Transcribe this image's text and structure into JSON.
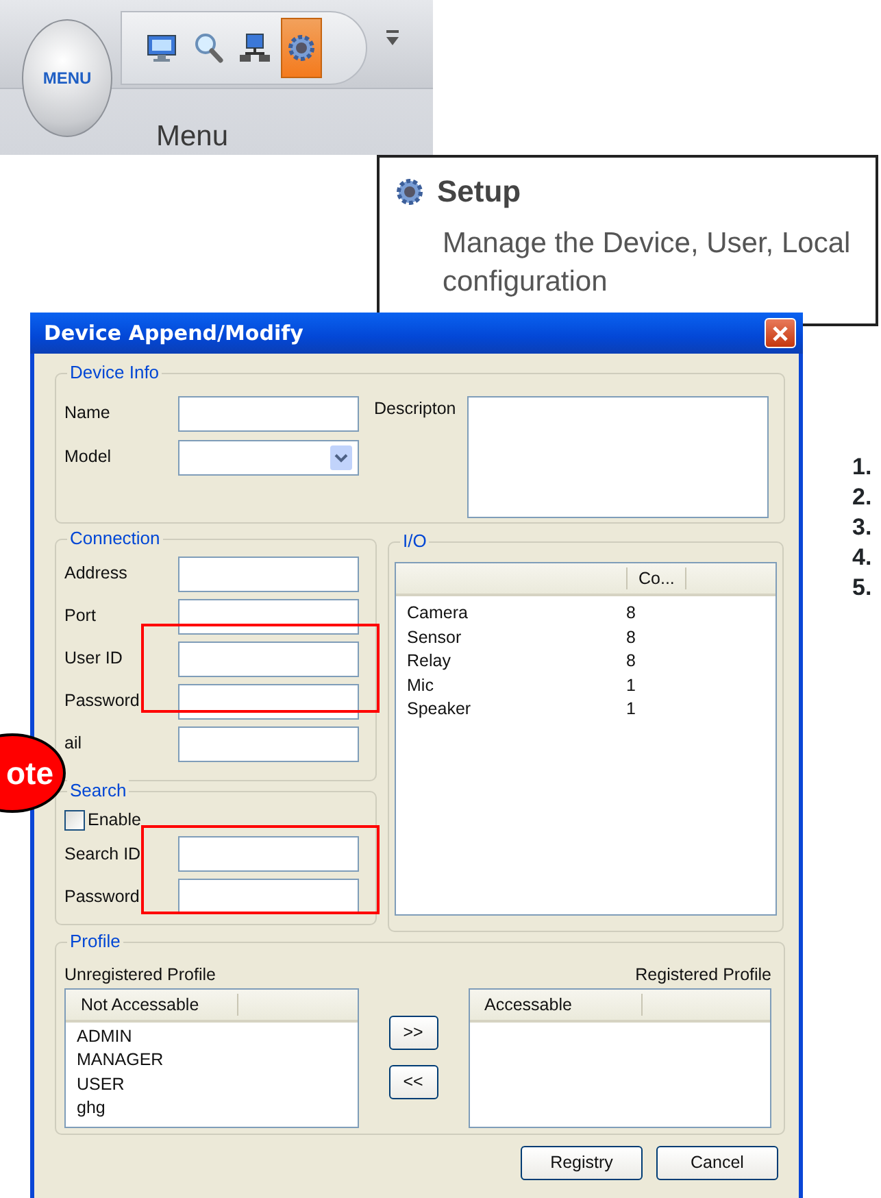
{
  "toolbar": {
    "menu_button": "MENU",
    "caption": "Menu",
    "tools": [
      {
        "kind": "monitor",
        "selected": false
      },
      {
        "kind": "search",
        "selected": false
      },
      {
        "kind": "network",
        "selected": false
      },
      {
        "kind": "gear",
        "selected": true
      }
    ]
  },
  "tooltip": {
    "title": "Setup",
    "description": "Manage the Device, User, Local configuration"
  },
  "dialog": {
    "title": "Device Append/Modify",
    "device_info": {
      "legend": "Device Info",
      "name_label": "Name",
      "model_label": "Model",
      "description_label": "Descripton"
    },
    "connection": {
      "legend": "Connection",
      "fields": [
        "Address",
        "Port",
        "User ID",
        "Password",
        "ail"
      ]
    },
    "search": {
      "legend": "Search",
      "enable": {
        "label": "Enable",
        "checked": false
      },
      "fields": [
        "Search ID",
        "Password"
      ]
    },
    "io": {
      "legend": "I/O",
      "columns": [
        "Co..."
      ],
      "rows": [
        {
          "name": "Camera",
          "count": "8"
        },
        {
          "name": "Sensor",
          "count": "8"
        },
        {
          "name": "Relay",
          "count": "8"
        },
        {
          "name": "Mic",
          "count": "1"
        },
        {
          "name": "Speaker",
          "count": "1"
        }
      ]
    },
    "profile": {
      "legend": "Profile",
      "unregistered_label": "Unregistered Profile",
      "registered_label": "Registered Profile",
      "unregistered_column": "Not Accessable",
      "unregistered_items": [
        "ADMIN",
        "MANAGER",
        "USER",
        "ghg"
      ],
      "registered_column": "Accessable",
      "move_buttons": [
        ">>",
        "<<"
      ]
    },
    "buttons": [
      "Registry",
      "Cancel"
    ]
  },
  "callout": "ote",
  "steps": [
    "1.",
    "2.",
    "3.",
    "4.",
    "5."
  ]
}
